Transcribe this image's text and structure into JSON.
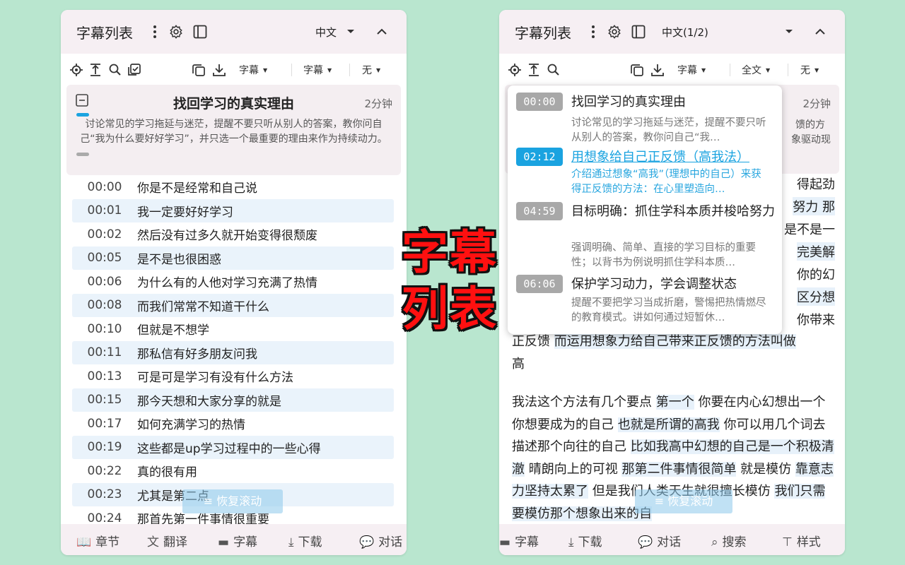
{
  "left": {
    "header": {
      "title": "字幕列表",
      "lang": "中文"
    },
    "toolbar": {
      "dd1": "字幕",
      "dd2": "字幕",
      "dd3": "无"
    },
    "card": {
      "title": "找回学习的真实理由",
      "duration": "2分钟",
      "summary": "讨论常见的学习拖延与迷茫，提醒不要只听从别人的答案，教你问自己“我为什么要好好学习”，并只选一个最重要的理由来作为持续动力。"
    },
    "rows": [
      {
        "time": "00:00",
        "text": "你是不是经常和自己说"
      },
      {
        "time": "00:01",
        "text": "我一定要好好学习"
      },
      {
        "time": "00:02",
        "text": "然后没有过多久就开始变得很颓废"
      },
      {
        "time": "00:05",
        "text": "是不是也很困惑"
      },
      {
        "time": "00:06",
        "text": "为什么有的人他对学习充满了热情"
      },
      {
        "time": "00:08",
        "text": "而我们常常不知道干什么"
      },
      {
        "time": "00:10",
        "text": "但就是不想学"
      },
      {
        "time": "00:11",
        "text": "那私信有好多朋友问我"
      },
      {
        "time": "00:13",
        "text": "可是可是学习有没有什么方法"
      },
      {
        "time": "00:15",
        "text": "那今天想和大家分享的就是"
      },
      {
        "time": "00:17",
        "text": "如何充满学习的热情"
      },
      {
        "time": "00:19",
        "text": "这些都是up学习过程中的一些心得"
      },
      {
        "time": "00:22",
        "text": "真的很有用"
      },
      {
        "time": "00:23",
        "text": "尤其是第二点"
      },
      {
        "time": "00:24",
        "text": "那首先第一件事情很重要"
      }
    ],
    "restore": "恢复滚动",
    "nav": [
      "章节",
      "翻译",
      "字幕",
      "下载",
      "对话"
    ]
  },
  "right": {
    "header": {
      "title": "字幕列表",
      "lang": "中文(1/2)"
    },
    "toolbar": {
      "dd1": "字幕",
      "dd2": "全文",
      "dd3": "无"
    },
    "card": {
      "duration": "2分钟",
      "frag1": "馈的方",
      "frag2": "象驱动现"
    },
    "popup": [
      {
        "time": "00:00",
        "title": "找回学习的真实理由",
        "desc": "讨论常见的学习拖延与迷茫，提醒不要只听从别人的答案，教你问自己“我…",
        "active": false
      },
      {
        "time": "02:12",
        "title": "用想象给自己正反馈（高我法）",
        "desc": "介绍通过想象“高我”（理想中的自己）来获得正反馈的方法：在心里塑造向…",
        "active": true
      },
      {
        "time": "04:59",
        "title": "目标明确：抓住学科本质并梭哈努力",
        "desc": "强调明确、简单、直接的学习目标的重要性；以背书为例说明抓住学科本质…",
        "active": false
      },
      {
        "time": "06:06",
        "title": "保护学习动力，学会调整状态",
        "desc": "提醒不要把学习当成折磨，警惕把热情燃尽的教育模式。讲如何通过短暂休…",
        "active": false
      }
    ],
    "peek": [
      "得起劲",
      "努力 那",
      "是不是一",
      "完美解",
      "你的幻",
      "区分想",
      "你带来"
    ],
    "para1_tail": [
      "正反馈 ",
      "而运用想象力给自己带来正反馈的方法叫做",
      "高"
    ],
    "para2": [
      {
        "t": "我法这个方法有几个要点 ",
        "h": false
      },
      {
        "t": "第一个",
        "h": true
      },
      {
        "t": " 你要在内心幻想出一个你想要成为的自己 ",
        "h": false
      },
      {
        "t": "也就是所谓的高我",
        "h": true
      },
      {
        "t": " 你可以用几个词去描述那个向往的自己 ",
        "h": false
      },
      {
        "t": "比如我高中幻想的自己是一个积极清澈",
        "h": true
      },
      {
        "t": " 晴朗向上的可视 ",
        "h": false
      },
      {
        "t": "那第二件事情很简单",
        "h": true
      },
      {
        "t": " 就是模仿 ",
        "h": false
      },
      {
        "t": "靠意志力坚持太累了",
        "h": true
      },
      {
        "t": " 但是我们人类天生就很擅长模仿 ",
        "h": false
      },
      {
        "t": "我们只需要模仿那个想象出来的自",
        "h": true
      }
    ],
    "restore": "恢复滚动",
    "nav": [
      "字幕",
      "下载",
      "对话",
      "搜索",
      "样式"
    ]
  },
  "overlay": [
    "字幕",
    "列表"
  ]
}
